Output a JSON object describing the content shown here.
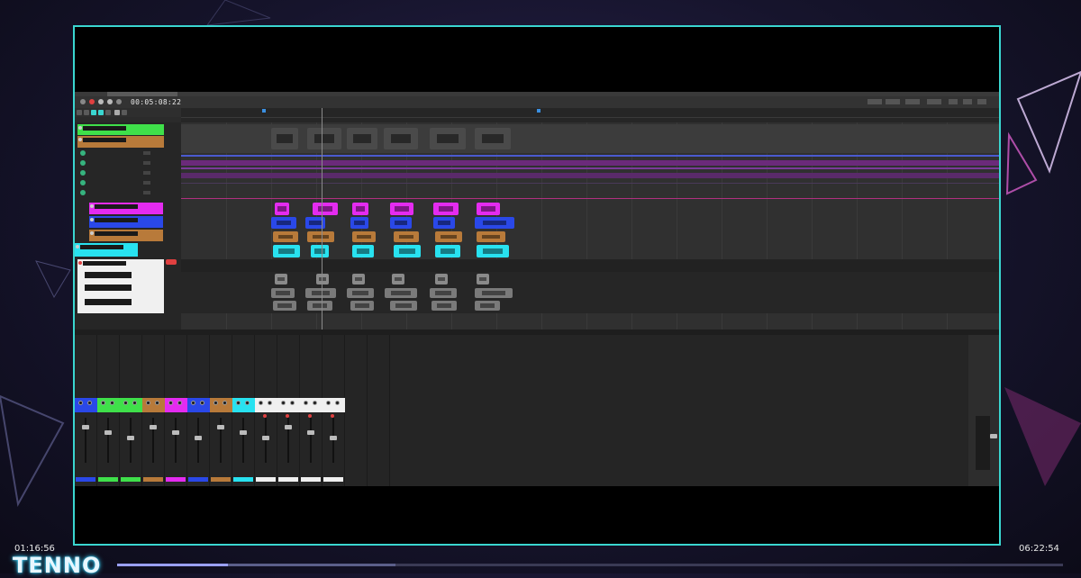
{
  "player": {
    "elapsed": "01:16:56",
    "duration": "06:22:54",
    "progress": 0.294,
    "buffered": 0.1,
    "brand": "TENNO"
  },
  "daw": {
    "transport_time": "00:05:08:22",
    "colors": {
      "green": "#3fe04a",
      "brown": "#b87a3a",
      "magenta": "#e42bf0",
      "blue": "#2a48e8",
      "cyan": "#28e2f0",
      "white": "#f0f0f0",
      "accent": "#3ad6d0"
    },
    "track_groups": [
      {
        "color": "#3fe04a",
        "rows": 1
      },
      {
        "color": "#b87a3a",
        "rows": 1
      },
      {
        "color": "#e42bf0",
        "rows": 1
      },
      {
        "color": "#2a48e8",
        "rows": 1
      },
      {
        "color": "#b87a3a",
        "rows": 1
      },
      {
        "color": "#28e2f0",
        "rows": 1
      },
      {
        "color": "#f0f0f0",
        "rows": 4
      }
    ],
    "mixer_strip_colors": [
      "#2a48e8",
      "#3fe04a",
      "#3fe04a",
      "#b87a3a",
      "#e42bf0",
      "#2a48e8",
      "#b87a3a",
      "#28e2f0",
      "#f0f0f0",
      "#f0f0f0",
      "#f0f0f0",
      "#f0f0f0"
    ]
  }
}
